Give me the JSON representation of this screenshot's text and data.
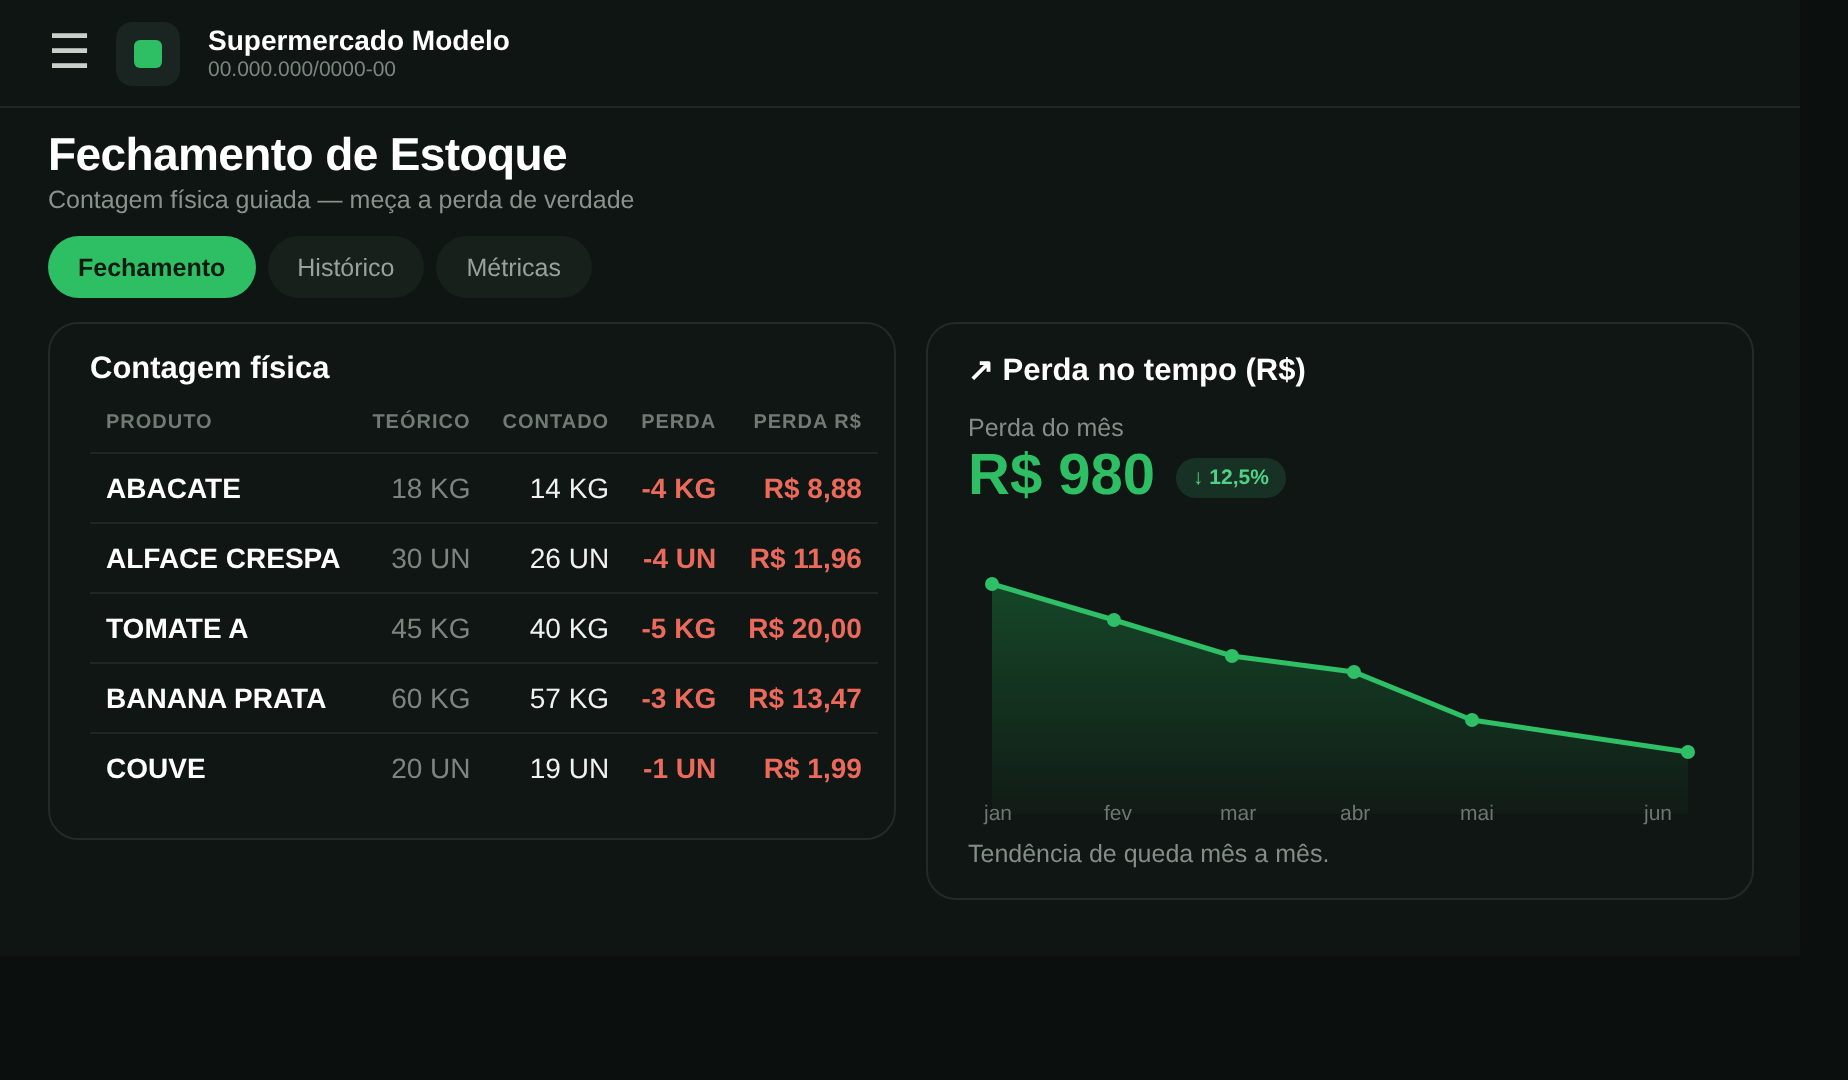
{
  "header": {
    "menu_icon": "☰",
    "store_name": "Supermercado Modelo",
    "store_id": "00.000.000/0000-00"
  },
  "page": {
    "title": "Fechamento de Estoque",
    "subtitle": "Contagem física guiada — meça a perda de verdade"
  },
  "tabs": [
    {
      "label": "Fechamento",
      "selected": true
    },
    {
      "label": "Histórico",
      "selected": false
    },
    {
      "label": "Métricas",
      "selected": false
    }
  ],
  "count_card": {
    "title": "Contagem física",
    "columns": [
      "PRODUTO",
      "TEÓRICO",
      "CONTADO",
      "PERDA",
      "PERDA R$"
    ],
    "rows": [
      [
        "ABACATE",
        "18 KG",
        "14 KG",
        "-4 KG",
        "R$ 8,88"
      ],
      [
        "ALFACE CRESPA",
        "30 UN",
        "26 UN",
        "-4 UN",
        "R$ 11,96"
      ],
      [
        "TOMATE A",
        "45 KG",
        "40 KG",
        "-5 KG",
        "R$ 20,00"
      ],
      [
        "BANANA PRATA",
        "60 KG",
        "57 KG",
        "-3 KG",
        "R$ 13,47"
      ],
      [
        "COUVE",
        "20 UN",
        "19 UN",
        "-1 UN",
        "R$ 1,99"
      ]
    ]
  },
  "loss_card": {
    "title": "↗ Perda no tempo (R$)",
    "label": "Perda do mês",
    "value": "R$ 980",
    "change": "↓ 12,5%",
    "months": [
      "jan",
      "fev",
      "mar",
      "abr",
      "mai",
      "jun"
    ],
    "note": "Tendência de queda mês a mês."
  }
}
